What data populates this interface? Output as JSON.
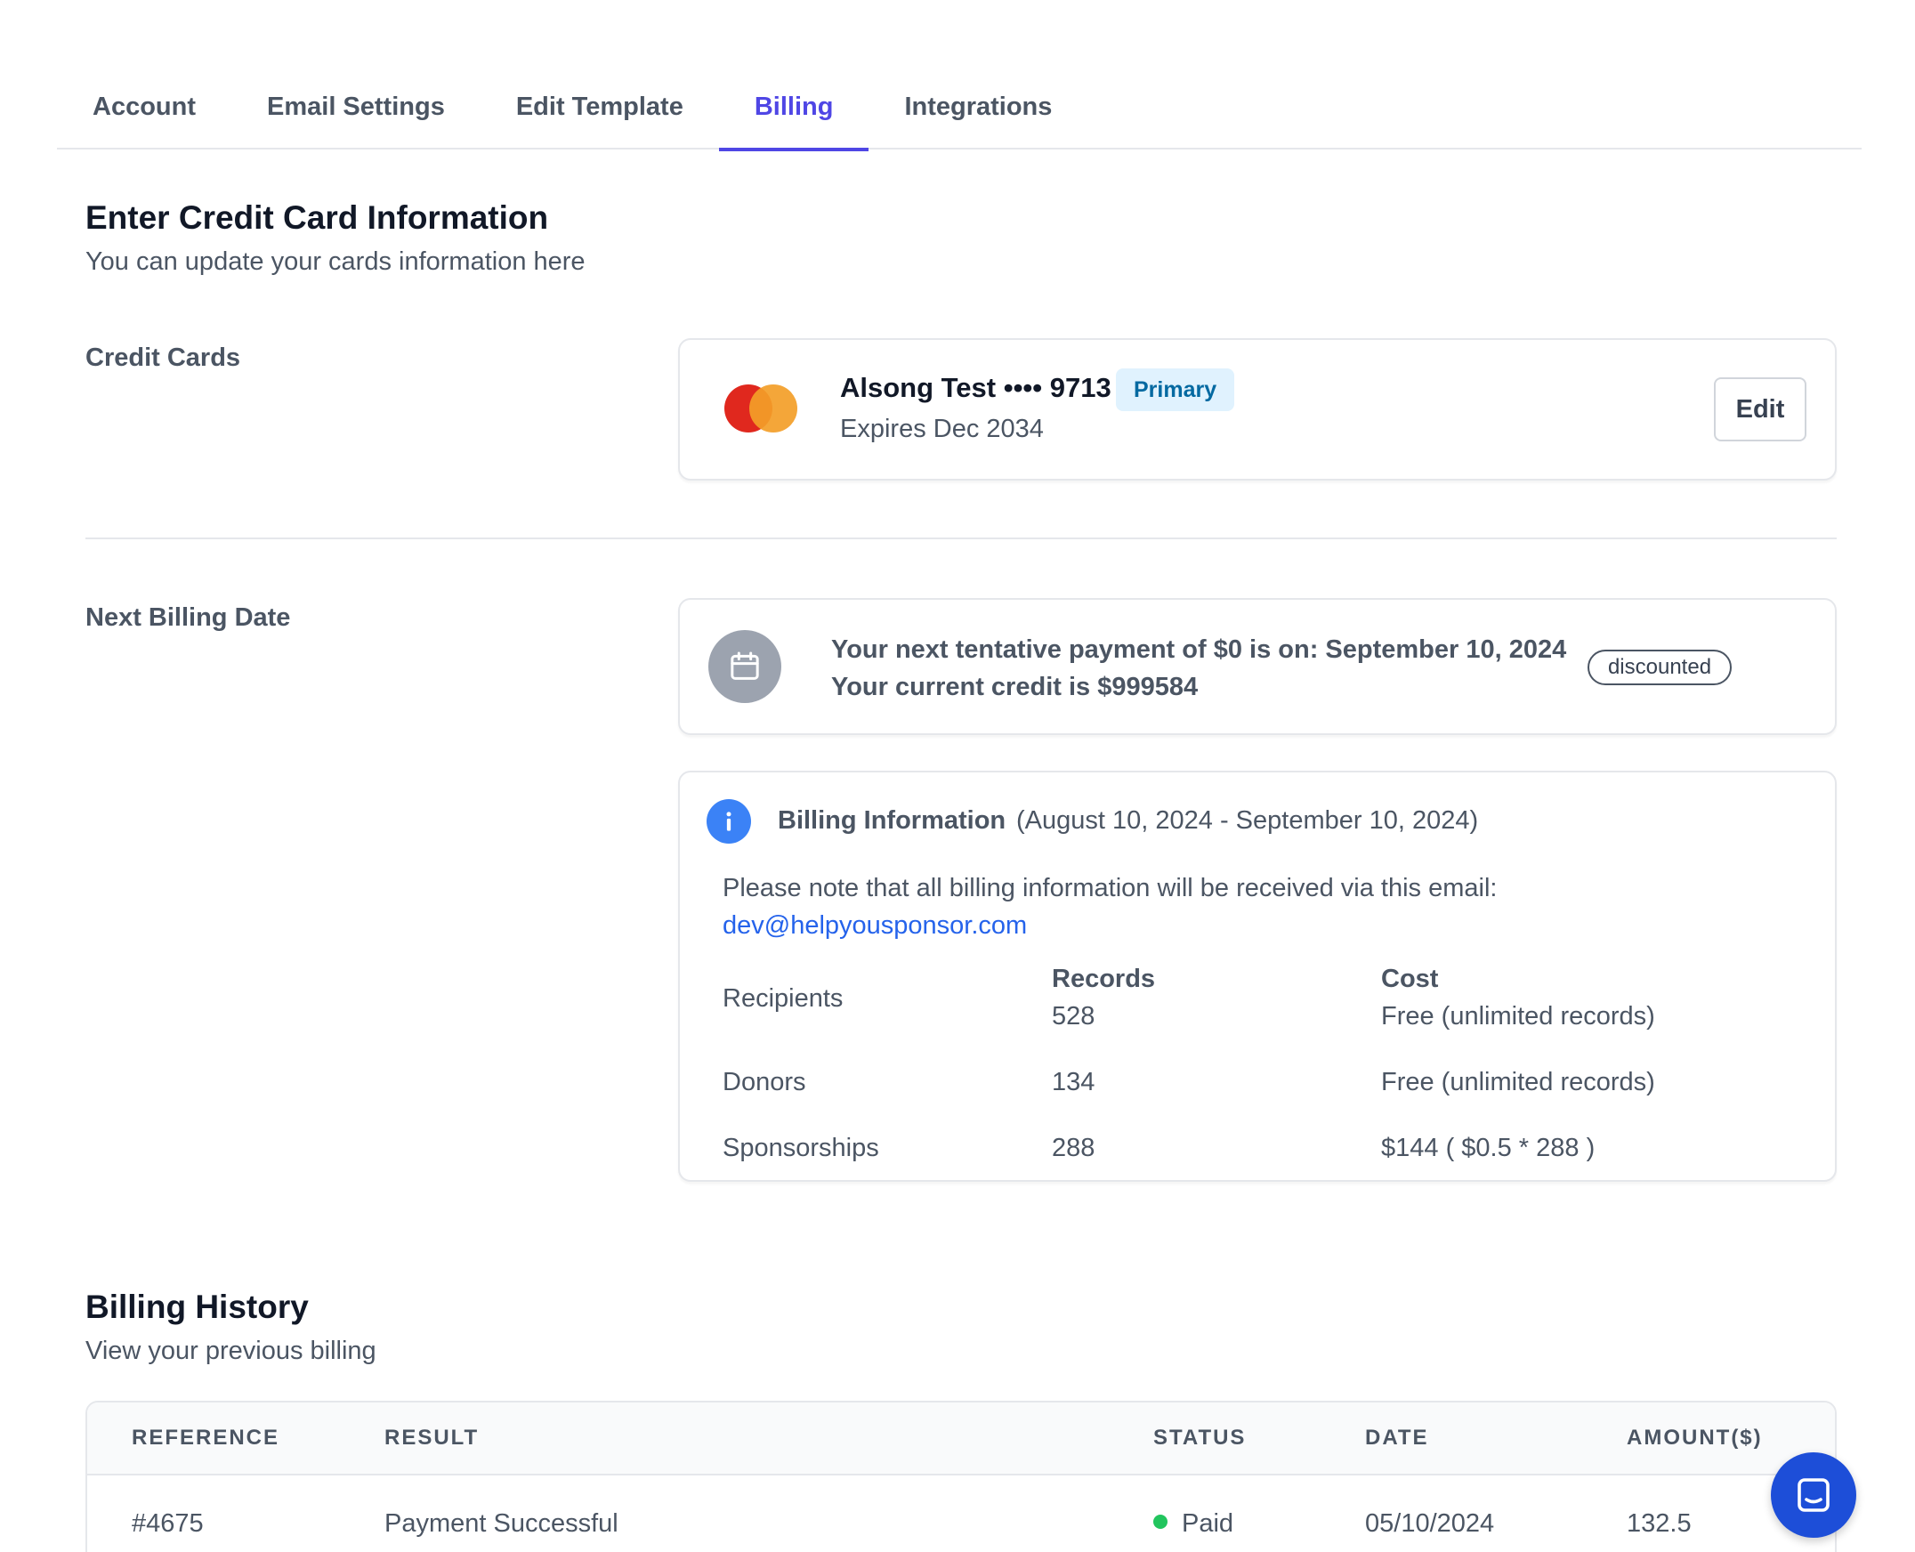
{
  "tabs": [
    {
      "label": "Account",
      "active": false
    },
    {
      "label": "Email Settings",
      "active": false
    },
    {
      "label": "Edit Template",
      "active": false
    },
    {
      "label": "Billing",
      "active": true
    },
    {
      "label": "Integrations",
      "active": false
    }
  ],
  "credit_section": {
    "title": "Enter Credit Card Information",
    "subtitle": "You can update your cards information here",
    "label": "Credit Cards",
    "card": {
      "name": "Alsong Test •••• 9713",
      "badge": "Primary",
      "expires": "Expires Dec 2034",
      "edit_label": "Edit",
      "brand_icon": "mastercard-icon"
    }
  },
  "next_billing": {
    "label": "Next Billing Date",
    "line1": "Your next tentative payment of $0 is on: September 10, 2024",
    "line2": "Your current credit is $999584",
    "badge": "discounted"
  },
  "billing_info": {
    "title": "Billing Information",
    "range": "(August 10, 2024 - September 10, 2024)",
    "note": "Please note that all billing information will be received via this email:",
    "email": "dev@helpyousponsor.com",
    "headers": {
      "records": "Records",
      "cost": "Cost"
    },
    "rows": [
      {
        "name": "Recipients",
        "records": "528",
        "cost": "Free (unlimited records)"
      },
      {
        "name": "Donors",
        "records": "134",
        "cost": "Free (unlimited records)"
      },
      {
        "name": "Sponsorships",
        "records": "288",
        "cost": "$144 ( $0.5 * 288 )"
      }
    ]
  },
  "history": {
    "title": "Billing History",
    "subtitle": "View your previous billing",
    "columns": [
      "REFERENCE",
      "RESULT",
      "STATUS",
      "DATE",
      "AMOUNT($)"
    ],
    "rows": [
      {
        "reference": "#4675",
        "result": "Payment Successful",
        "status": "Paid",
        "date": "05/10/2024",
        "amount": "132.5"
      }
    ]
  },
  "colors": {
    "accent": "#4f46e5",
    "link": "#2563eb",
    "status_paid": "#22c55e",
    "chat_button": "#1d4ed8"
  },
  "icons": {
    "calendar": "calendar-icon",
    "info": "info-icon",
    "chat": "chat-icon"
  }
}
